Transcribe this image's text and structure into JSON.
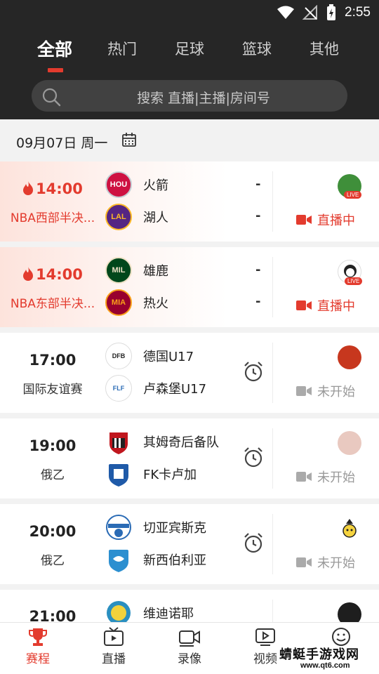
{
  "status_bar": {
    "time": "2:55"
  },
  "tabs": [
    {
      "label": "全部",
      "active": true
    },
    {
      "label": "热门"
    },
    {
      "label": "足球"
    },
    {
      "label": "篮球"
    },
    {
      "label": "其他"
    }
  ],
  "search": {
    "placeholder": "搜索 直播|主播|房间号"
  },
  "date": {
    "text": "09月07日  周一"
  },
  "matches": [
    {
      "time": "14:00",
      "league": "NBA西部半决...",
      "live": true,
      "home": {
        "name": "火箭",
        "abbr": "HOU",
        "color": "#ce1141"
      },
      "away": {
        "name": "湖人",
        "abbr": "LAL",
        "color": "#552583"
      },
      "home_score": "-",
      "away_score": "-",
      "status": "直播中",
      "avatar_tag": "LIVE"
    },
    {
      "time": "14:00",
      "league": "NBA东部半决...",
      "live": true,
      "home": {
        "name": "雄鹿",
        "abbr": "MIL",
        "color": "#00471b"
      },
      "away": {
        "name": "热火",
        "abbr": "MIA",
        "color": "#98002e"
      },
      "home_score": "-",
      "away_score": "-",
      "status": "直播中",
      "avatar_tag": "LIVE"
    },
    {
      "time": "17:00",
      "league": "国际友谊赛",
      "live": false,
      "home": {
        "name": "德国U17",
        "abbr": "DFB",
        "color": "#ffffff"
      },
      "away": {
        "name": "卢森堡U17",
        "abbr": "FLF",
        "color": "#ffffff"
      },
      "status": "未开始"
    },
    {
      "time": "19:00",
      "league": "俄乙",
      "live": false,
      "home": {
        "name": "其姆奇后备队",
        "abbr": "",
        "color": "#c0161e"
      },
      "away": {
        "name": "FK卡卢加",
        "abbr": "",
        "color": "#1f5aa8"
      },
      "status": "未开始"
    },
    {
      "time": "20:00",
      "league": "俄乙",
      "live": false,
      "home": {
        "name": "切亚宾斯克",
        "abbr": "",
        "color": "#2a6bb5"
      },
      "away": {
        "name": "新西伯利亚",
        "abbr": "",
        "color": "#2c8fd0"
      },
      "status": "未开始"
    },
    {
      "time": "21:00",
      "league": "",
      "live": false,
      "home": {
        "name": "维迪诺耶",
        "abbr": "",
        "color": "#2a8fc0"
      }
    }
  ],
  "bottom_nav": [
    {
      "label": "赛程",
      "icon": "trophy-icon",
      "active": true
    },
    {
      "label": "直播",
      "icon": "tv-icon"
    },
    {
      "label": "录像",
      "icon": "video-camera-icon"
    },
    {
      "label": "视频",
      "icon": "play-screen-icon"
    },
    {
      "label": "",
      "icon": "smiley-icon"
    }
  ],
  "watermark": {
    "text": "蜻蜓手游戏网",
    "url": "www.qt6.com"
  },
  "colors": {
    "accent": "#e33b2e",
    "header_bg": "#262626"
  }
}
